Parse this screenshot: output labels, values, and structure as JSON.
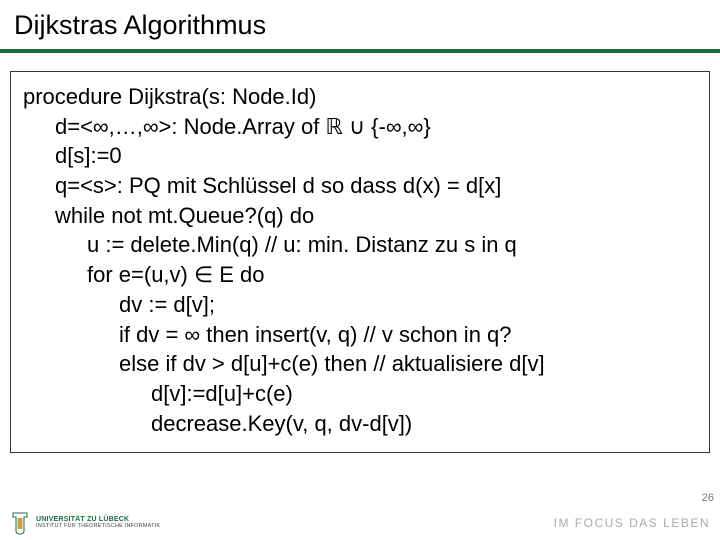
{
  "title": "Dijkstras Algorithmus",
  "code": {
    "l1": "procedure Dijkstra(s: Node.Id)",
    "l2": "d=<∞,…,∞>: Node.Array of ℝ ∪ {-∞,∞}",
    "l3": "d[s]:=0",
    "l4": "q=<s>: PQ mit Schlüssel d so dass d(x) = d[x]",
    "l5": "while not mt.Queue?(q) do",
    "l6": "u := delete.Min(q)  // u: min. Distanz zu s in q",
    "l7": "for e=(u,v) ∈ E do",
    "l8": "dv := d[v];",
    "l9": "if dv = ∞ then insert(v, q) // v schon in q?",
    "l10": "else if dv > d[u]+c(e) then // aktualisiere d[v]",
    "l11": "d[v]:=d[u]+c(e)",
    "l12": "decrease.Key(v, q, dv-d[v])"
  },
  "footer": {
    "uni_name": "UNIVERSITÄT ZU LÜBECK",
    "uni_sub": "INSTITUT FÜR THEORETISCHE INFORMATIK",
    "tagline": "IM FOCUS DAS LEBEN"
  },
  "page_number": "26",
  "colors": {
    "accent": "#196d41"
  }
}
